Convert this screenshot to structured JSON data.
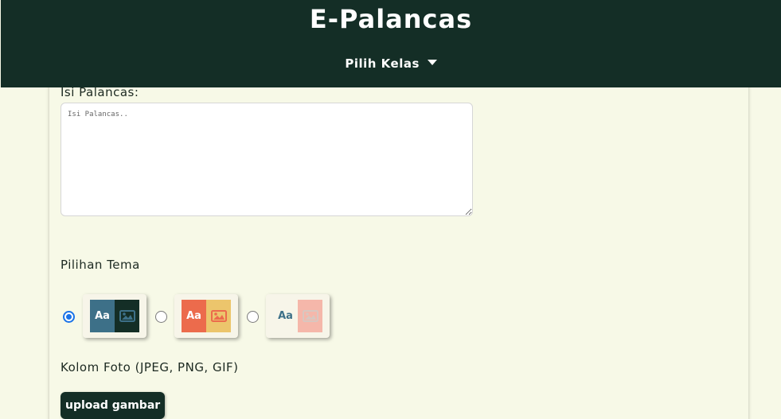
{
  "header": {
    "brand": "E-Palancas",
    "class_picker_label": "Pilih Kelas",
    "background_color": "#142e26"
  },
  "form": {
    "isi_label": "Isi Palancas:",
    "isi_placeholder": "Isi Palancas..",
    "tema_label": "Pilihan Tema",
    "themes": [
      {
        "text": "Aa",
        "text_color": "#3d7088",
        "image_color": "#142e26",
        "selected": true
      },
      {
        "text": "Aa",
        "text_color": "#ec6b4c",
        "image_color": "#ecc56c",
        "selected": false
      },
      {
        "text": "Aa",
        "text_color": "#f7f5e9",
        "image_color": "#f5b7aa",
        "selected": false
      }
    ],
    "foto_label": "Kolom Foto (JPEG, PNG, GIF)",
    "upload_label": "upload gambar"
  }
}
